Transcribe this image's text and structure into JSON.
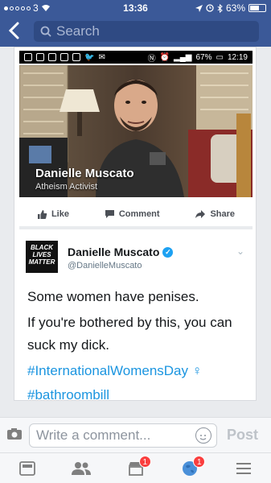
{
  "status_bar": {
    "carrier": "3",
    "time": "13:36",
    "battery": "63%",
    "battery_level": 0.63
  },
  "navbar": {
    "search_placeholder": "Search"
  },
  "screenshot": {
    "android_time": "12:19",
    "android_battery": "67%",
    "video_name": "Danielle Muscato",
    "video_caption": "Atheism Activist",
    "actions": {
      "like": "Like",
      "comment": "Comment",
      "share": "Share"
    },
    "tweet": {
      "avatar_text": "BLACK LIVES MATTER",
      "name": "Danielle Muscato",
      "handle": "@DanielleMuscato",
      "line1": "Some women have penises.",
      "line2": "If you're bothered by this, you can",
      "line3": "suck my dick.",
      "hashtag1": "#InternationalWomensDay ♀",
      "hashtag2": "#bathroombill"
    }
  },
  "comment_bar": {
    "placeholder": "Write a comment...",
    "post_label": "Post"
  },
  "tabbar": {
    "badge_marketplace": "1",
    "badge_notifications": "1"
  },
  "colors": {
    "brand": "#3b5998",
    "link": "#1b95e0",
    "badge": "#fa3e3e"
  }
}
